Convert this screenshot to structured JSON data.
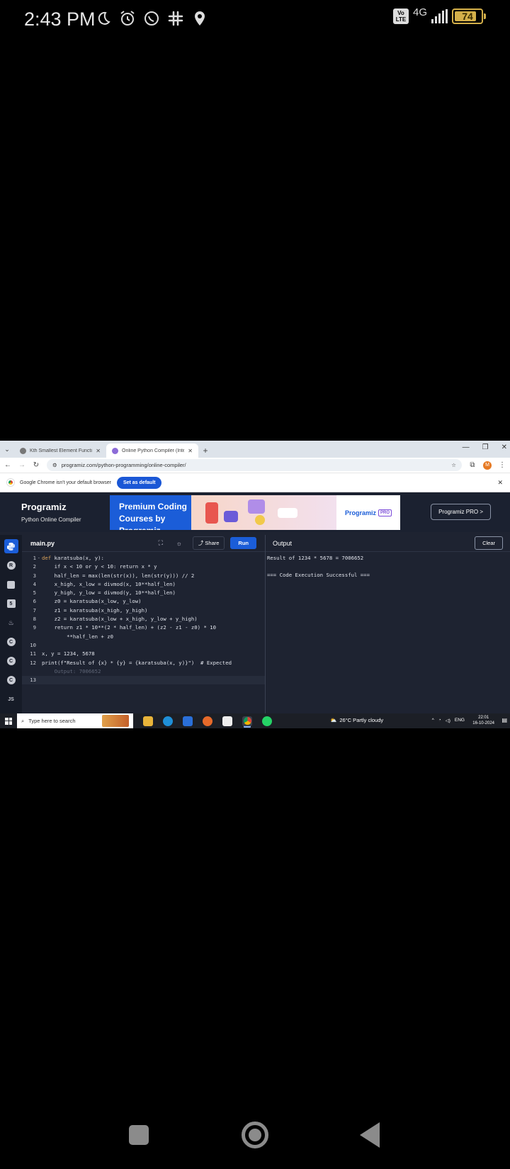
{
  "status_bar": {
    "time": "2:43 PM",
    "network": "4G",
    "volte": "Vo LTE",
    "battery": "74",
    "icons": [
      "moon-icon",
      "alarm-icon",
      "whatsapp-icon",
      "slack-icon",
      "location-icon"
    ]
  },
  "browser": {
    "tabs": [
      {
        "title": "Kth Smallest Element Function"
      },
      {
        "title": "Online Python Compiler (Interp"
      }
    ],
    "url": "programiz.com/python-programming/online-compiler/",
    "infobar_text": "Google Chrome isn't your default browser",
    "infobar_button": "Set as default",
    "profile_initial": "M"
  },
  "programiz": {
    "logo": "Programiz",
    "subtitle": "Python Online Compiler",
    "banner_text_line1": "Premium Coding",
    "banner_text_line2": "Courses by Programiz",
    "banner_brand": "Programiz",
    "banner_pro": "PRO",
    "pro_button": "Programiz PRO >"
  },
  "editor": {
    "file_name": "main.py",
    "share_label": "Share",
    "run_label": "Run",
    "lines": [
      {
        "n": "1",
        "fold": "-"
      },
      {
        "n": "2"
      },
      {
        "n": "3"
      },
      {
        "n": "4"
      },
      {
        "n": "5"
      },
      {
        "n": "6"
      },
      {
        "n": "7"
      },
      {
        "n": "8"
      },
      {
        "n": "9"
      },
      {
        "n": ""
      },
      {
        "n": "10"
      },
      {
        "n": "11"
      },
      {
        "n": "12"
      },
      {
        "n": ""
      },
      {
        "n": "13"
      }
    ],
    "code": {
      "l1_kw": "def",
      "l1_rest": " karatsuba(x, y):",
      "l2": "    if x < 10 or y < 10: return x * y",
      "l3": "    half_len = max(len(str(x)), len(str(y))) // 2",
      "l4": "    x_high, x_low = divmod(x, 10**half_len)",
      "l5": "    y_high, y_low = divmod(y, 10**half_len)",
      "l6": "    z0 = karatsuba(x_low, y_low)",
      "l7": "    z1 = karatsuba(x_high, y_high)",
      "l8": "    z2 = karatsuba(x_low + x_high, y_low + y_high)",
      "l9": "    return z1 * 10**(2 * half_len) + (z2 - z1 - z0) * 10",
      "l9b": "        **half_len + z0",
      "l10": "",
      "l11": "x, y = 1234, 5678",
      "l12": "print(f\"Result of {x} * {y} = {karatsuba(x, y)}\")  # Expected",
      "l12b": "    Output: 7006652",
      "l13": ""
    }
  },
  "output": {
    "title": "Output",
    "clear_label": "Clear",
    "line1": "Result of 1234 * 5678 = 7006652",
    "line2": "",
    "line3": "=== Code Execution Successful ==="
  },
  "taskbar": {
    "search_placeholder": "Type here to search",
    "weather": "26°C  Partly cloudy",
    "lang": "ENG",
    "time": "22:01",
    "date": "16-10-2024"
  },
  "sidebar_langs": [
    "python-icon",
    "r-icon",
    "sql-icon",
    "html-icon",
    "java-icon",
    "c-icon",
    "cpp-icon",
    "csharp-icon",
    "js-icon"
  ]
}
